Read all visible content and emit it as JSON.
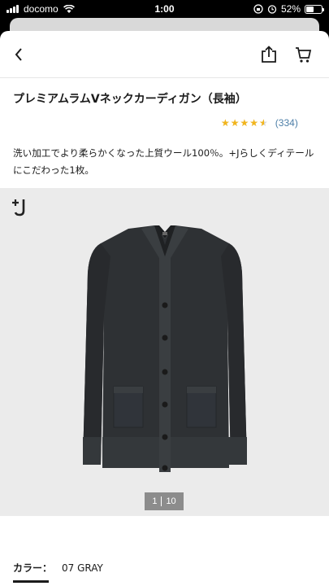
{
  "status_bar": {
    "carrier": "docomo",
    "time": "1:00",
    "battery": "52%",
    "battery_level": 0.52
  },
  "product": {
    "title": "プレミアムラムVネックカーディガン（長袖）",
    "rating_value": 4.5,
    "review_count": "(334)",
    "description": "洗い加工でより柔らかくなった上質ウール100％。+Jらしくディテールにこだわった1枚。"
  },
  "gallery": {
    "brand_logo": "+J",
    "current_index": "1",
    "total": "10"
  },
  "color": {
    "label": "カラー：",
    "value": "07 GRAY"
  },
  "icons": {
    "back": "chevron-left-icon",
    "share": "share-icon",
    "cart": "cart-icon",
    "star": "star-icon"
  },
  "colors": {
    "accent_star": "#f2b51b",
    "link": "#4d7fa8",
    "garment": "#2e3134"
  }
}
